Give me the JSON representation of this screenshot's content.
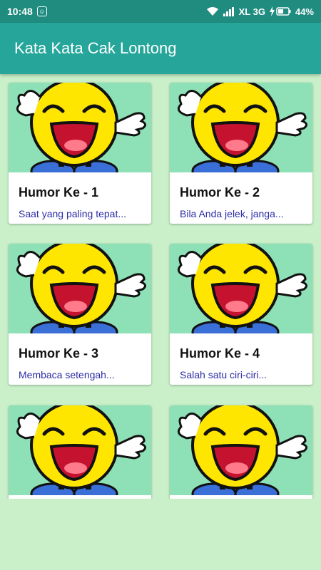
{
  "status_bar": {
    "time": "10:48",
    "network": "XL 3G",
    "battery": "44%",
    "icons": [
      "app-notification-icon",
      "wifi-icon",
      "signal-icon",
      "battery-charging-icon"
    ]
  },
  "app_bar": {
    "title": "Kata Kata Cak Lontong"
  },
  "cards": [
    {
      "title": "Humor Ke - 1",
      "desc": "Saat yang paling tepat..."
    },
    {
      "title": "Humor Ke - 2",
      "desc": "Bila Anda jelek, janga..."
    },
    {
      "title": "Humor Ke - 3",
      "desc": "Membaca setengah..."
    },
    {
      "title": "Humor Ke - 4",
      "desc": "Salah satu ciri-ciri..."
    },
    {
      "title": "",
      "desc": ""
    },
    {
      "title": "",
      "desc": ""
    }
  ],
  "colors": {
    "status_bar": "#1f8c7f",
    "app_bar": "#26a69a",
    "background": "#c9f0c9",
    "image_bg": "#8ee0b6",
    "desc_text": "#2c2ca8"
  }
}
